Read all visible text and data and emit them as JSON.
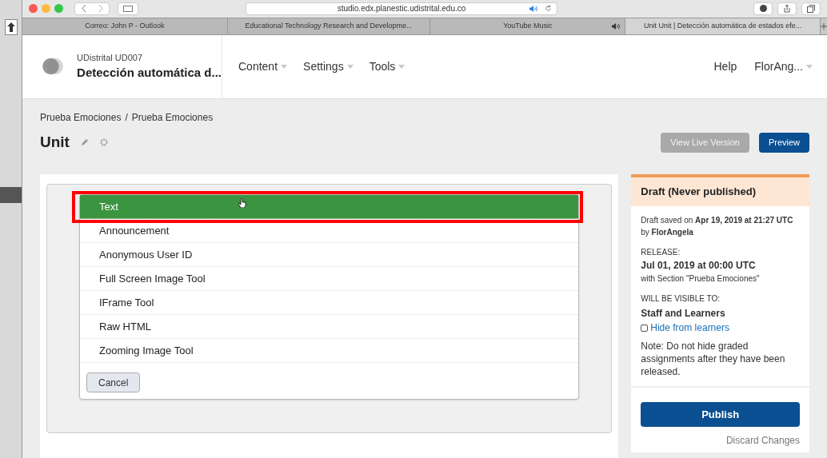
{
  "browser": {
    "address": "studio.edx.planestic.udistrital.edu.co",
    "tabs": [
      {
        "label": "Correo: John P - Outlook",
        "selected": false,
        "audio": false
      },
      {
        "label": "Educational Technology Research and Developme...",
        "selected": false,
        "audio": false
      },
      {
        "label": "YouTube Music",
        "selected": false,
        "audio": true
      },
      {
        "label": "Unit Unit | Detección automática de estados efe...",
        "selected": true,
        "audio": false
      }
    ]
  },
  "header": {
    "org": "UDistrital UD007",
    "course": "Detección automática d...",
    "nav": [
      "Content",
      "Settings",
      "Tools"
    ],
    "help": "Help",
    "user": "FlorAng..."
  },
  "breadcrumb": [
    "Prueba Emociones",
    "Prueba Emociones"
  ],
  "breadcrumb_separator": "/",
  "page_title": "Unit",
  "actions": {
    "view_live": {
      "label": "View Live Version",
      "disabled": true
    },
    "preview": "Preview"
  },
  "component_menu": {
    "items": [
      {
        "label": "Text",
        "selected": true
      },
      {
        "label": "Announcement",
        "selected": false
      },
      {
        "label": "Anonymous User ID",
        "selected": false
      },
      {
        "label": "Full Screen Image Tool",
        "selected": false
      },
      {
        "label": "IFrame Tool",
        "selected": false
      },
      {
        "label": "Raw HTML",
        "selected": false
      },
      {
        "label": "Zooming Image Tool",
        "selected": false
      }
    ],
    "cancel": "Cancel"
  },
  "status": {
    "title": "Draft (Never published)",
    "saved": "Draft saved on **Apr 19, 2019 at 21:27 UTC** by **FlorAngela**",
    "release_label": "RELEASE:",
    "release_date": "Jul 01, 2019 at 00:00 UTC",
    "release_section": "with Section \"Prueba Emociones\"",
    "visible_label": "WILL BE VISIBLE TO:",
    "visible_value": "Staff and Learners",
    "hide": {
      "label": "Hide from learners",
      "checked": false
    },
    "note": "Note: Do not hide graded assignments after they have been released.",
    "publish": "Publish",
    "discard": "Discard Changes"
  }
}
